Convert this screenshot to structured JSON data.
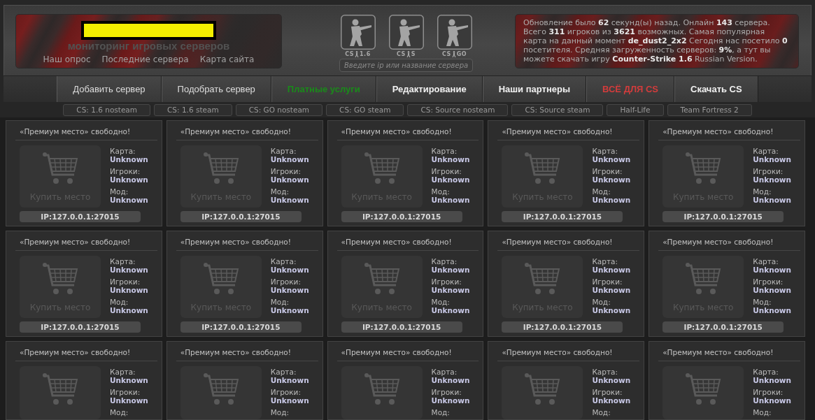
{
  "header": {
    "tagline": "мониторинг игровых серверов",
    "links": [
      "Наш опрос",
      "Последние сервера",
      "Карта сайта"
    ],
    "games": [
      {
        "prefix": "CS",
        "version": "1.6"
      },
      {
        "prefix": "CS",
        "version": "S"
      },
      {
        "prefix": "CS",
        "version": "GO"
      }
    ],
    "search": {
      "placeholder": "Введите ip или название сервера"
    },
    "stats": "Обновление было **62** секунд(ы) назад. Онлайн **143** сервера. Всего **311** игроков из **3621** возможных. Самая популярная карта на данный момент **de_dust2_2x2** Сегодня нас посетило **0** посетителя. Средняя загруженность серверов: **9%**, а тут вы можете скачать игру **Counter-Strike 1.6** Russian Version."
  },
  "nav": [
    {
      "label": "Добавить сервер",
      "kind": "plain",
      "color": "#dcdcdc"
    },
    {
      "label": "Подобрать сервер",
      "kind": "plain",
      "color": "#dcdcdc"
    },
    {
      "label": "Платные услуги",
      "kind": "bold",
      "color": "#1a8a1a"
    },
    {
      "label": "Редактирование",
      "kind": "bold",
      "color": "#f0f0f0"
    },
    {
      "label": "Наши партнеры",
      "kind": "bold",
      "color": "#f0f0f0"
    },
    {
      "label": "ВСЁ ДЛЯ CS",
      "kind": "bold",
      "color": "#d23c3c"
    },
    {
      "label": "Скачать CS",
      "kind": "bold",
      "color": "#f0f0f0"
    }
  ],
  "categories": [
    "CS: 1.6 nosteam",
    "CS: 1.6 steam",
    "CS: GO nosteam",
    "CS: GO steam",
    "CS: Source nosteam",
    "CS: Source steam",
    "Half-Life",
    "Team Fortress 2"
  ],
  "cards": [
    {
      "title": "«Премиум место» свободно!",
      "buy_label": "Купить место",
      "fields": [
        {
          "label": "Карта:",
          "value": "Unknown"
        },
        {
          "label": "Игроки:",
          "value": "Unknown"
        },
        {
          "label": "Мод:",
          "value": "Unknown"
        }
      ],
      "ip": "IP:127.0.0.1:27015"
    },
    {
      "title": "«Премиум место» свободно!",
      "buy_label": "Купить место",
      "fields": [
        {
          "label": "Карта:",
          "value": "Unknown"
        },
        {
          "label": "Игроки:",
          "value": "Unknown"
        },
        {
          "label": "Мод:",
          "value": "Unknown"
        }
      ],
      "ip": "IP:127.0.0.1:27015"
    },
    {
      "title": "«Премиум место» свободно!",
      "buy_label": "Купить место",
      "fields": [
        {
          "label": "Карта:",
          "value": "Unknown"
        },
        {
          "label": "Игроки:",
          "value": "Unknown"
        },
        {
          "label": "Мод:",
          "value": "Unknown"
        }
      ],
      "ip": "IP:127.0.0.1:27015"
    },
    {
      "title": "«Премиум место» свободно!",
      "buy_label": "Купить место",
      "fields": [
        {
          "label": "Карта:",
          "value": "Unknown"
        },
        {
          "label": "Игроки:",
          "value": "Unknown"
        },
        {
          "label": "Мод:",
          "value": "Unknown"
        }
      ],
      "ip": "IP:127.0.0.1:27015"
    },
    {
      "title": "«Премиум место» свободно!",
      "buy_label": "Купить место",
      "fields": [
        {
          "label": "Карта:",
          "value": "Unknown"
        },
        {
          "label": "Игроки:",
          "value": "Unknown"
        },
        {
          "label": "Мод:",
          "value": "Unknown"
        }
      ],
      "ip": "IP:127.0.0.1:27015"
    },
    {
      "title": "«Премиум место» свободно!",
      "buy_label": "Купить место",
      "fields": [
        {
          "label": "Карта:",
          "value": "Unknown"
        },
        {
          "label": "Игроки:",
          "value": "Unknown"
        },
        {
          "label": "Мод:",
          "value": "Unknown"
        }
      ],
      "ip": "IP:127.0.0.1:27015"
    },
    {
      "title": "«Премиум место» свободно!",
      "buy_label": "Купить место",
      "fields": [
        {
          "label": "Карта:",
          "value": "Unknown"
        },
        {
          "label": "Игроки:",
          "value": "Unknown"
        },
        {
          "label": "Мод:",
          "value": "Unknown"
        }
      ],
      "ip": "IP:127.0.0.1:27015"
    },
    {
      "title": "«Премиум место» свободно!",
      "buy_label": "Купить место",
      "fields": [
        {
          "label": "Карта:",
          "value": "Unknown"
        },
        {
          "label": "Игроки:",
          "value": "Unknown"
        },
        {
          "label": "Мод:",
          "value": "Unknown"
        }
      ],
      "ip": "IP:127.0.0.1:27015"
    },
    {
      "title": "«Премиум место» свободно!",
      "buy_label": "Купить место",
      "fields": [
        {
          "label": "Карта:",
          "value": "Unknown"
        },
        {
          "label": "Игроки:",
          "value": "Unknown"
        },
        {
          "label": "Мод:",
          "value": "Unknown"
        }
      ],
      "ip": "IP:127.0.0.1:27015"
    },
    {
      "title": "«Премиум место» свободно!",
      "buy_label": "Купить место",
      "fields": [
        {
          "label": "Карта:",
          "value": "Unknown"
        },
        {
          "label": "Игроки:",
          "value": "Unknown"
        },
        {
          "label": "Мод:",
          "value": "Unknown"
        }
      ],
      "ip": "IP:127.0.0.1:27015"
    },
    {
      "title": "«Премиум место» свободно!",
      "fields": [
        {
          "label": "Карта:",
          "value": "Unknown"
        },
        {
          "label": "Игроки:",
          "value": "Unknown"
        },
        {
          "label": "Мод:"
        }
      ]
    },
    {
      "title": "«Премиум место» свободно!",
      "fields": [
        {
          "label": "Карта:",
          "value": "Unknown"
        },
        {
          "label": "Игроки:",
          "value": "Unknown"
        },
        {
          "label": "Мод:"
        }
      ]
    },
    {
      "title": "«Премиум место» свободно!",
      "fields": [
        {
          "label": "Карта:",
          "value": "Unknown"
        },
        {
          "label": "Игроки:",
          "value": "Unknown"
        },
        {
          "label": "Мод:"
        }
      ]
    },
    {
      "title": "«Премиум место» свободно!",
      "fields": [
        {
          "label": "Карта:",
          "value": "Unknown"
        },
        {
          "label": "Игроки:",
          "value": "Unknown"
        },
        {
          "label": "Мод:"
        }
      ]
    },
    {
      "title": "«Премиум место» свободно!",
      "fields": [
        {
          "label": "Карта:",
          "value": "Unknown"
        },
        {
          "label": "Игроки:",
          "value": "Unknown"
        },
        {
          "label": "Мод:"
        }
      ]
    }
  ]
}
